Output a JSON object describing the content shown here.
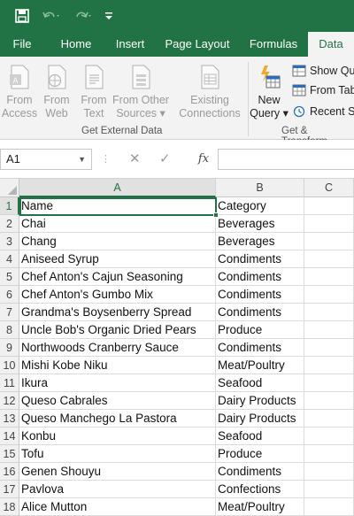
{
  "colors": {
    "accent": "#217346",
    "ribbon": "#f3f3f3",
    "header": "#f0f0f0"
  },
  "qat": {
    "save_icon": "save-icon",
    "undo_icon": "undo-icon",
    "redo_icon": "redo-icon",
    "customize_icon": "customize-qat-icon"
  },
  "tabs": [
    "File",
    "Home",
    "Insert",
    "Page Layout",
    "Formulas",
    "Data"
  ],
  "active_tab": "Data",
  "ribbon": {
    "get_external_data": {
      "label": "Get External Data",
      "buttons": [
        {
          "line1": "From",
          "line2": "Access",
          "icon": "access-icon"
        },
        {
          "line1": "From",
          "line2": "Web",
          "icon": "web-icon"
        },
        {
          "line1": "From",
          "line2": "Text",
          "icon": "text-file-icon"
        },
        {
          "line1": "From Other",
          "line2": "Sources ▾",
          "icon": "other-sources-icon"
        },
        {
          "line1": "Existing",
          "line2": "Connections",
          "icon": "connections-icon"
        }
      ]
    },
    "get_transform": {
      "label": "Get & Transform",
      "new_query": {
        "line1": "New",
        "line2": "Query ▾",
        "icon": "new-query-icon"
      },
      "show_queries": "Show Que",
      "from_table": "From Tab",
      "recent_sources": "Recent So"
    }
  },
  "formula_bar": {
    "name_box": "A1",
    "fx": "fx",
    "value": ""
  },
  "grid": {
    "columns": [
      "A",
      "B",
      "C"
    ],
    "selected_column": "A",
    "rows": [
      {
        "num": "1",
        "a": "Name",
        "b": "Category"
      },
      {
        "num": "2",
        "a": "Chai",
        "b": "Beverages"
      },
      {
        "num": "3",
        "a": "Chang",
        "b": "Beverages"
      },
      {
        "num": "4",
        "a": "Aniseed Syrup",
        "b": "Condiments"
      },
      {
        "num": "5",
        "a": "Chef Anton's Cajun Seasoning",
        "b": "Condiments"
      },
      {
        "num": "6",
        "a": "Chef Anton's Gumbo Mix",
        "b": "Condiments"
      },
      {
        "num": "7",
        "a": "Grandma's Boysenberry Spread",
        "b": "Condiments"
      },
      {
        "num": "8",
        "a": "Uncle Bob's Organic Dried Pears",
        "b": "Produce"
      },
      {
        "num": "9",
        "a": "Northwoods Cranberry Sauce",
        "b": "Condiments"
      },
      {
        "num": "10",
        "a": "Mishi Kobe Niku",
        "b": "Meat/Poultry"
      },
      {
        "num": "11",
        "a": "Ikura",
        "b": "Seafood"
      },
      {
        "num": "12",
        "a": "Queso Cabrales",
        "b": "Dairy Products"
      },
      {
        "num": "13",
        "a": "Queso Manchego La Pastora",
        "b": "Dairy Products"
      },
      {
        "num": "14",
        "a": "Konbu",
        "b": "Seafood"
      },
      {
        "num": "15",
        "a": "Tofu",
        "b": "Produce"
      },
      {
        "num": "16",
        "a": "Genen Shouyu",
        "b": "Condiments"
      },
      {
        "num": "17",
        "a": "Pavlova",
        "b": "Confections"
      },
      {
        "num": "18",
        "a": "Alice Mutton",
        "b": "Meat/Poultry"
      }
    ]
  }
}
